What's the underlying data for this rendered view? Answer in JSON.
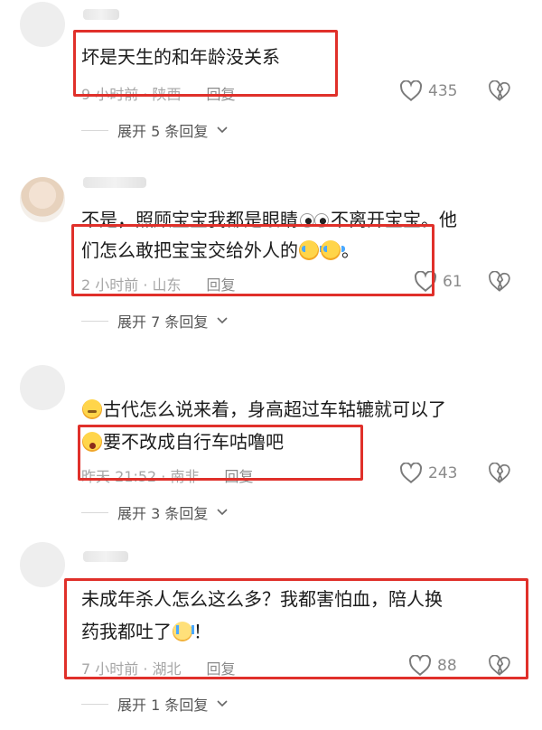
{
  "comments": [
    {
      "text_lines": [
        "坏是天生的和年龄没关系"
      ],
      "meta": "9 小时前 · 陕西",
      "reply_label": "回复",
      "likes": "435",
      "expand_label": "展开 5 条回复"
    },
    {
      "text_line1": "不是，照顾宝宝我都是眼睛",
      "emoji_eyes": "eyes-emoji",
      "text_line1b": "不离开宝宝。他",
      "text_line2": "们怎么敢把宝宝交给外人的",
      "emoji_laughcry": "laugh-cry-emoji",
      "text_line2_end": "。",
      "meta": "2 小时前 · 山东",
      "reply_label": "回复",
      "likes": "61",
      "expand_label": "展开 7 条回复"
    },
    {
      "emoji_think": "thinking-emoji",
      "text_line1": "古代怎么说来着，身高超过车轱辘就可以了",
      "emoji_shocked": "shocked-emoji",
      "text_line2": "要不改成自行车咕噜吧",
      "meta": "昨天 21:52 · 南非",
      "reply_label": "回复",
      "likes": "243",
      "expand_label": "展开 3 条回复"
    },
    {
      "text_line1": "未成年杀人怎么这么多？我都害怕血，陪人换",
      "text_line2": "药我都吐了",
      "emoji_sob": "crying-emoji",
      "text_line2_end": "！",
      "meta": "7 小时前 · 湖北",
      "reply_label": "回复",
      "likes": "88",
      "expand_label": "展开 1 条回复"
    }
  ],
  "icons": {
    "like": "heart-outline-icon",
    "dislike": "broken-heart-icon",
    "expand": "chevron-down-icon"
  },
  "colors": {
    "highlight_box": "#e0302a",
    "meta_text": "#a6a6a6",
    "body_text": "#1b1b1b"
  }
}
